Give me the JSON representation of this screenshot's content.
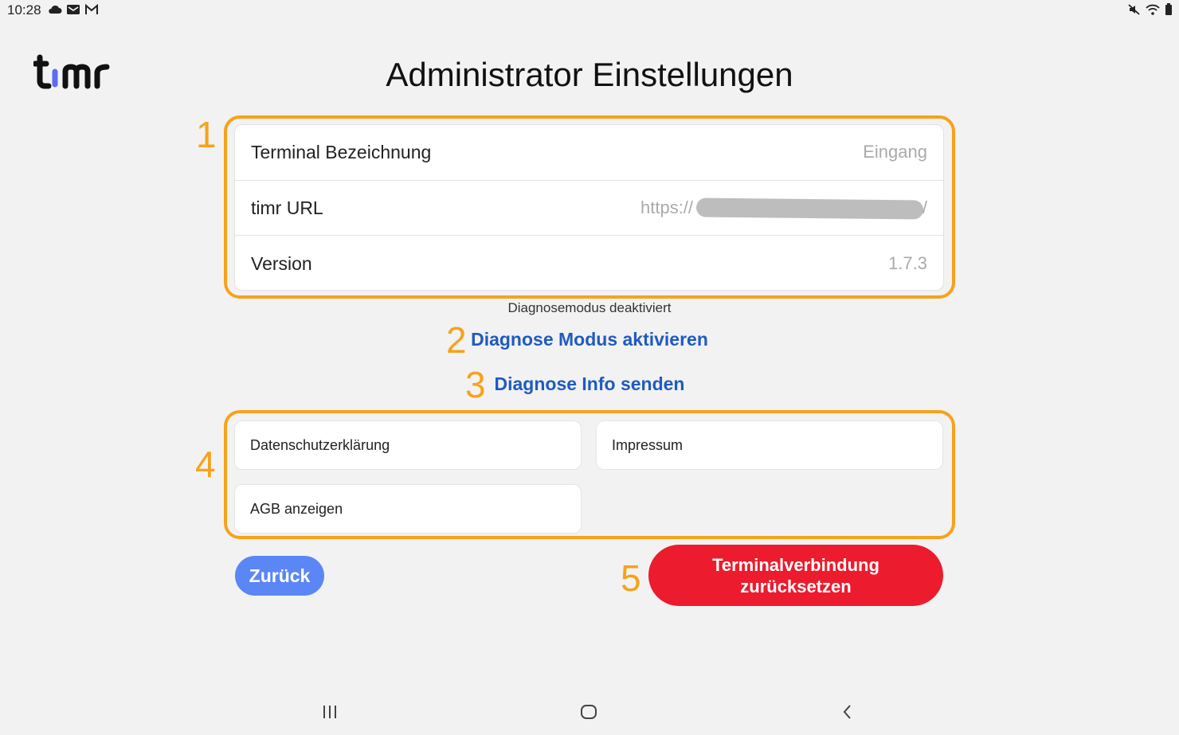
{
  "status_bar": {
    "time": "10:28",
    "left_icons": [
      "cloud-icon",
      "mail-icon",
      "gmail-icon"
    ],
    "right_icons": [
      "mute-icon",
      "wifi-icon",
      "battery-icon"
    ]
  },
  "logo": {
    "text": "timr",
    "accent_color": "#5b6cf0"
  },
  "page": {
    "title": "Administrator Einstellungen"
  },
  "annotations": [
    "1",
    "2",
    "3",
    "4",
    "5"
  ],
  "settings": {
    "rows": [
      {
        "label": "Terminal Bezeichnung",
        "value": "Eingang"
      },
      {
        "label": "timr URL",
        "value": "https://",
        "value_suffix": "/"
      },
      {
        "label": "Version",
        "value": "1.7.3"
      }
    ]
  },
  "diagnose": {
    "status": "Diagnosemodus deaktiviert",
    "activate_label": "Diagnose Modus aktivieren",
    "send_label": "Diagnose Info senden"
  },
  "links": {
    "privacy": "Datenschutzerklärung",
    "imprint": "Impressum",
    "terms": "AGB anzeigen"
  },
  "actions": {
    "back_label": "Zurück",
    "reset_label_line1": "Terminalverbindung",
    "reset_label_line2": "zurücksetzen"
  },
  "colors": {
    "annotation": "#f7a21b",
    "link": "#1f5bbf",
    "back_button": "#5b86f5",
    "reset_button": "#ec1b2d",
    "background": "#f2f2f2"
  }
}
